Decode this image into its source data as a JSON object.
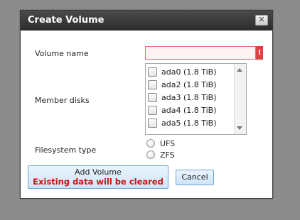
{
  "dialog": {
    "title": "Create Volume",
    "close_glyph": "✕"
  },
  "form": {
    "volume_name_label": "Volume name",
    "volume_name_value": "",
    "volume_name_error_icon": "!",
    "member_disks_label": "Member disks",
    "disks": [
      {
        "label": "ada0 (1.8 TiB)",
        "checked": false
      },
      {
        "label": "ada2 (1.8 TiB)",
        "checked": false
      },
      {
        "label": "ada3 (1.8 TiB)",
        "checked": false
      },
      {
        "label": "ada4 (1.8 TiB)",
        "checked": false
      },
      {
        "label": "ada5 (1.8 TiB)",
        "checked": false
      }
    ],
    "filesystem_label": "Filesystem type",
    "filesystem_options": [
      "UFS",
      "ZFS"
    ],
    "filesystem_selected": null
  },
  "buttons": {
    "add_volume_label": "Add Volume",
    "add_volume_warning": "Existing data will be cleared",
    "cancel_label": "Cancel"
  },
  "colors": {
    "error": "#d84545",
    "warning_text": "#d01010",
    "button_border": "#6fa2d6"
  }
}
